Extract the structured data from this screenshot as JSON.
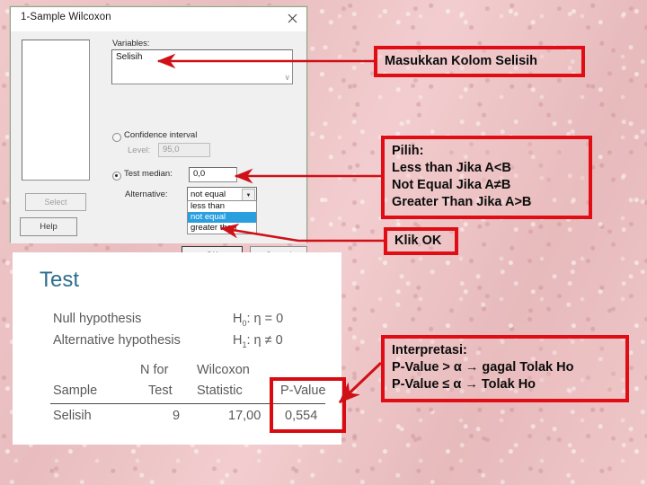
{
  "dialog": {
    "title": "1-Sample Wilcoxon",
    "close_icon": "close-icon",
    "variables_label": "Variables:",
    "variables_value": "Selisih",
    "scroll_glyph": "∨",
    "confidence_interval_label": "Confidence interval",
    "level_label": "Level:",
    "level_value": "95,0",
    "test_median_label": "Test median:",
    "test_median_value": "0,0",
    "alternative_label": "Alternative:",
    "alternative_value": "not equal",
    "alternative_options": [
      "less than",
      "not equal",
      "greater than"
    ],
    "alternative_selected_index": 1,
    "dropdown_arrow_glyph": "▼",
    "select_button": "Select",
    "help_button": "Help",
    "ok_button": "OK",
    "cancel_button": "Cancel"
  },
  "results": {
    "title": "Test",
    "null_hypothesis_label": "Null hypothesis",
    "null_hypothesis_expr_pre": "H",
    "null_hypothesis_expr_sub": "0",
    "null_hypothesis_expr_post": ": η = 0",
    "alt_hypothesis_label": "Alternative hypothesis",
    "alt_hypothesis_expr_pre": "H",
    "alt_hypothesis_expr_sub": "1",
    "alt_hypothesis_expr_post": ": η ≠ 0",
    "header_nfor": "N for",
    "header_wilcoxon": "Wilcoxon",
    "header_sample": "Sample",
    "header_test": "Test",
    "header_statistic": "Statistic",
    "header_pvalue": "P-Value",
    "row_sample": "Selisih",
    "row_n": "9",
    "row_statistic": "17,00",
    "row_pvalue": "0,554"
  },
  "annotations": {
    "callout_1": "Masukkan Kolom Selisih",
    "callout_2": {
      "line1": "Pilih:",
      "line2": "Less than Jika A<B",
      "line3": "Not Equal Jika A≠B",
      "line4": "Greater Than Jika A>B"
    },
    "callout_3": "Klik OK",
    "callout_4": {
      "line1": "Interpretasi:",
      "line2": "P-Value > α → gagal Tolak Ho",
      "line3": "P-Value ≤ α → Tolak Ho"
    }
  },
  "colors": {
    "annotation_red": "#e00d14",
    "background_pink": "#eec4c6",
    "results_title_blue": "#2e6d8e",
    "dropdown_highlight": "#2a9fe0"
  }
}
